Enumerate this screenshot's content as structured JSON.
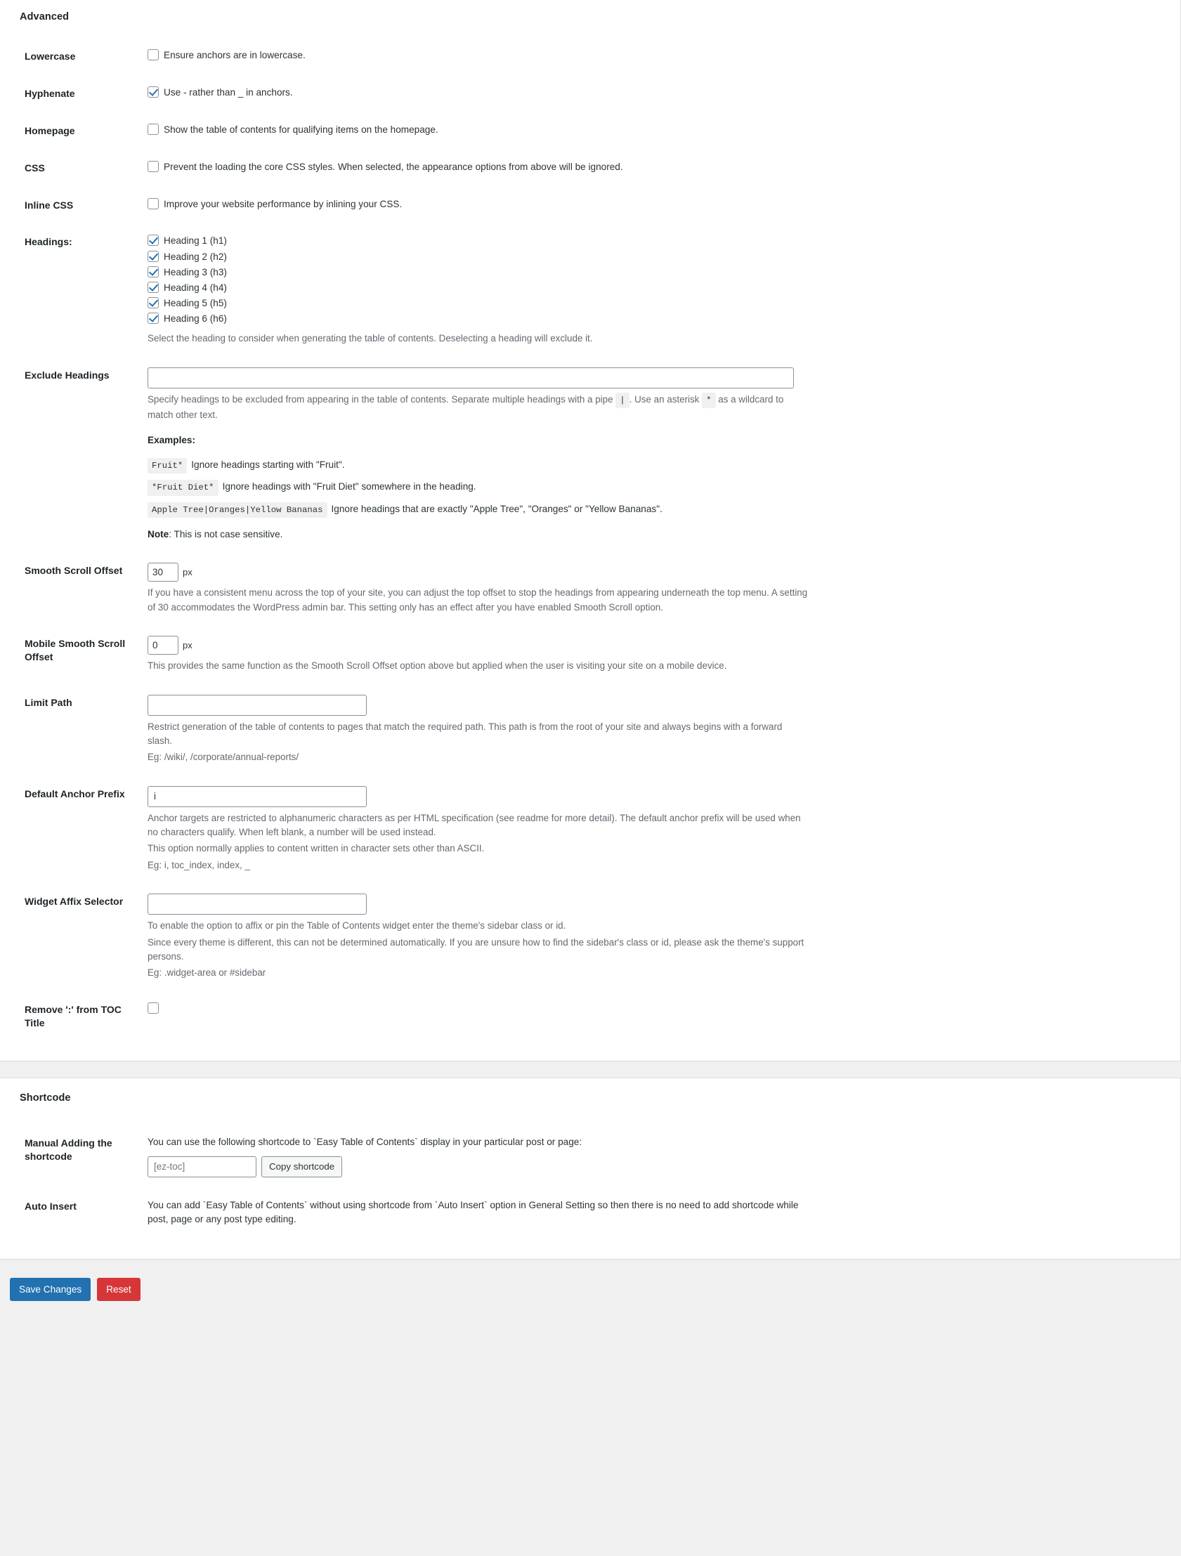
{
  "advanced": {
    "section_title": "Advanced",
    "rows": {
      "lowercase": {
        "label": "Lowercase",
        "checkbox_label": "Ensure anchors are in lowercase.",
        "checked": false
      },
      "hyphenate": {
        "label": "Hyphenate",
        "checkbox_label": "Use - rather than _ in anchors.",
        "checked": true
      },
      "homepage": {
        "label": "Homepage",
        "checkbox_label": "Show the table of contents for qualifying items on the homepage.",
        "checked": false
      },
      "css": {
        "label": "CSS",
        "checkbox_label": "Prevent the loading the core CSS styles. When selected, the appearance options from above will be ignored.",
        "checked": false
      },
      "inline_css": {
        "label": "Inline CSS",
        "checkbox_label": "Improve your website performance by inlining your CSS.",
        "checked": false
      },
      "headings": {
        "label": "Headings:",
        "items": [
          {
            "label": "Heading 1 (h1)",
            "checked": true
          },
          {
            "label": "Heading 2 (h2)",
            "checked": true
          },
          {
            "label": "Heading 3 (h3)",
            "checked": true
          },
          {
            "label": "Heading 4 (h4)",
            "checked": true
          },
          {
            "label": "Heading 5 (h5)",
            "checked": true
          },
          {
            "label": "Heading 6 (h6)",
            "checked": true
          }
        ],
        "description": "Select the heading to consider when generating the table of contents. Deselecting a heading will exclude it."
      },
      "exclude_headings": {
        "label": "Exclude Headings",
        "value": "",
        "placeholder": "",
        "desc_part1": "Specify headings to be excluded from appearing in the table of contents. Separate multiple headings with a pipe",
        "pipe_code": "|",
        "desc_part2": ". Use an asterisk",
        "asterisk_code": "*",
        "desc_part3": "as a wildcard to match other text."
      },
      "examples": {
        "title": "Examples:",
        "rows": [
          {
            "code": "Fruit*",
            "text": "Ignore headings starting with \"Fruit\"."
          },
          {
            "code": "*Fruit Diet*",
            "text": "Ignore headings with \"Fruit Diet\" somewhere in the heading."
          },
          {
            "code": "Apple Tree|Oranges|Yellow Bananas",
            "text": "Ignore headings that are exactly \"Apple Tree\", \"Oranges\" or \"Yellow Bananas\"."
          }
        ],
        "note_label": "Note",
        "note_text": ": This is not case sensitive."
      },
      "smooth_scroll_offset": {
        "label": "Smooth Scroll Offset",
        "value": "30",
        "unit": "px",
        "description": "If you have a consistent menu across the top of your site, you can adjust the top offset to stop the headings from appearing underneath the top menu. A setting of 30 accommodates the WordPress admin bar. This setting only has an effect after you have enabled Smooth Scroll option."
      },
      "mobile_smooth_scroll_offset": {
        "label": "Mobile Smooth Scroll Offset",
        "value": "0",
        "unit": "px",
        "description": "This provides the same function as the Smooth Scroll Offset option above but applied when the user is visiting your site on a mobile device."
      },
      "limit_path": {
        "label": "Limit Path",
        "value": "",
        "description": "Restrict generation of the table of contents to pages that match the required path. This path is from the root of your site and always begins with a forward slash.",
        "eg": "Eg: /wiki/, /corporate/annual-reports/"
      },
      "default_anchor_prefix": {
        "label": "Default Anchor Prefix",
        "value": "i",
        "description_line1": "Anchor targets are restricted to alphanumeric characters as per HTML specification (see readme for more detail). The default anchor prefix will be used when no characters qualify. When left blank, a number will be used instead.",
        "description_line2": "This option normally applies to content written in character sets other than ASCII.",
        "eg": "Eg: i, toc_index, index, _"
      },
      "widget_affix_selector": {
        "label": "Widget Affix Selector",
        "value": "",
        "description_line1": "To enable the option to affix or pin the Table of Contents widget enter the theme's sidebar class or id.",
        "description_line2": "Since every theme is different, this can not be determined automatically. If you are unsure how to find the sidebar's class or id, please ask the theme's support persons.",
        "eg": "Eg: .widget-area or #sidebar"
      },
      "remove_colon": {
        "label": "Remove ':' from TOC Title",
        "checked": false
      }
    }
  },
  "shortcode": {
    "section_title": "Shortcode",
    "manual": {
      "label": "Manual Adding the shortcode",
      "description": "You can use the following shortcode to `Easy Table of Contents` display in your particular post or page:",
      "input_value": "",
      "input_placeholder": "[ez-toc]",
      "copy_button": "Copy shortcode"
    },
    "auto_insert": {
      "label": "Auto Insert",
      "description": "You can add `Easy Table of Contents` without using shortcode from `Auto Insert` option in General Setting so then there is no need to add shortcode while post, page or any post type editing."
    }
  },
  "footer": {
    "save_label": "Save Changes",
    "reset_label": "Reset",
    "save_color": "#2271b1",
    "reset_color": "#d63638"
  }
}
